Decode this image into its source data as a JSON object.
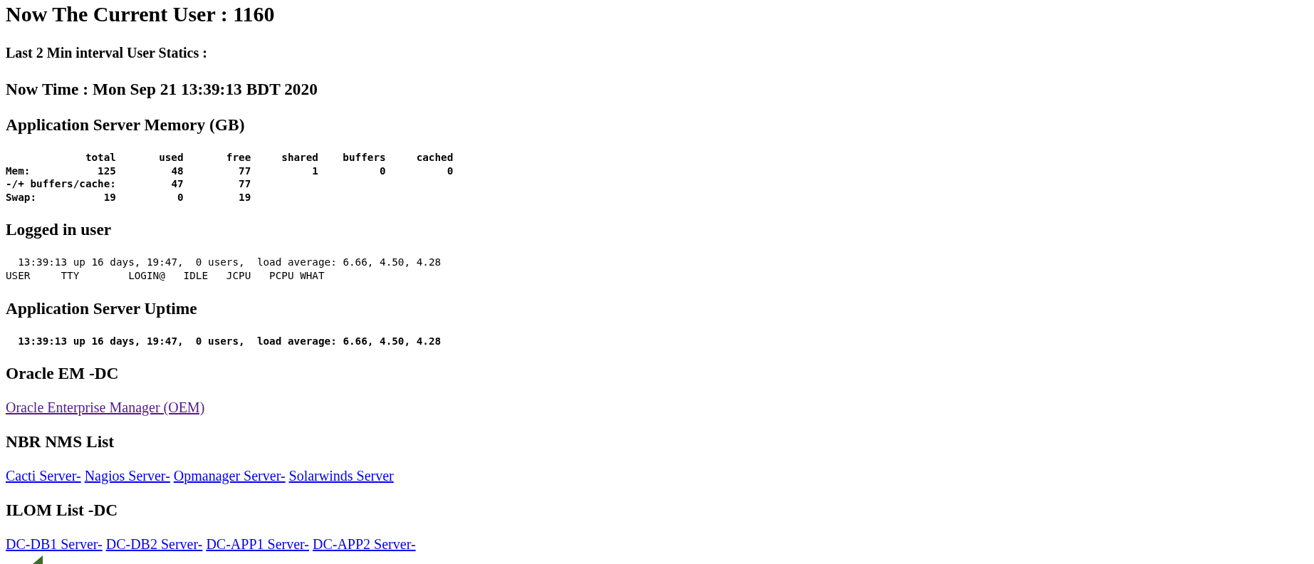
{
  "title": "Now The Current User : 1160",
  "subtitle": "Last 2 Min interval User Statics :",
  "now_time": "Now Time : Mon Sep 21 13:39:13 BDT 2020",
  "memory": {
    "heading": "Application Server Memory (GB)",
    "columns": [
      "total",
      "used",
      "free",
      "shared",
      "buffers",
      "cached"
    ],
    "rows": [
      {
        "label": "Mem:",
        "values": [
          "125",
          "48",
          "77",
          "1",
          "0",
          "0"
        ],
        "spans_total": false
      },
      {
        "label": "-/+ buffers/cache:",
        "values": [
          "47",
          "77"
        ],
        "spans_total": true
      },
      {
        "label": "Swap:",
        "values": [
          "19",
          "0",
          "19"
        ],
        "spans_total": false
      }
    ]
  },
  "logged_in": {
    "heading": "Logged in user",
    "lines": [
      "13:39:13 up 16 days, 19:47,  0 users,  load average: 6.66, 4.50, 4.28",
      "USER     TTY        LOGIN@   IDLE   JCPU   PCPU WHAT"
    ],
    "indent": [
      true,
      false
    ]
  },
  "uptime": {
    "heading": "Application Server Uptime",
    "line": "13:39:13 up 16 days, 19:47,  0 users,  load average: 6.66, 4.50, 4.28"
  },
  "sections": [
    {
      "heading": "Oracle EM -DC",
      "links": [
        {
          "label": "Oracle Enterprise Manager (OEM)",
          "visited": true
        }
      ]
    },
    {
      "heading": "NBR NMS List",
      "links": [
        {
          "label": "Cacti Server-",
          "visited": false
        },
        {
          "label": "Nagios Server-",
          "visited": false
        },
        {
          "label": "Opmanager Server-",
          "visited": false
        },
        {
          "label": "Solarwinds Server",
          "visited": false
        }
      ]
    },
    {
      "heading": "ILOM List -DC",
      "links": [
        {
          "label": "DC-DB1 Server-",
          "visited": false
        },
        {
          "label": "DC-DB2 Server-",
          "visited": false
        },
        {
          "label": "DC-APP1 Server-",
          "visited": false
        },
        {
          "label": "DC-APP2 Server-",
          "visited": false
        }
      ]
    }
  ]
}
